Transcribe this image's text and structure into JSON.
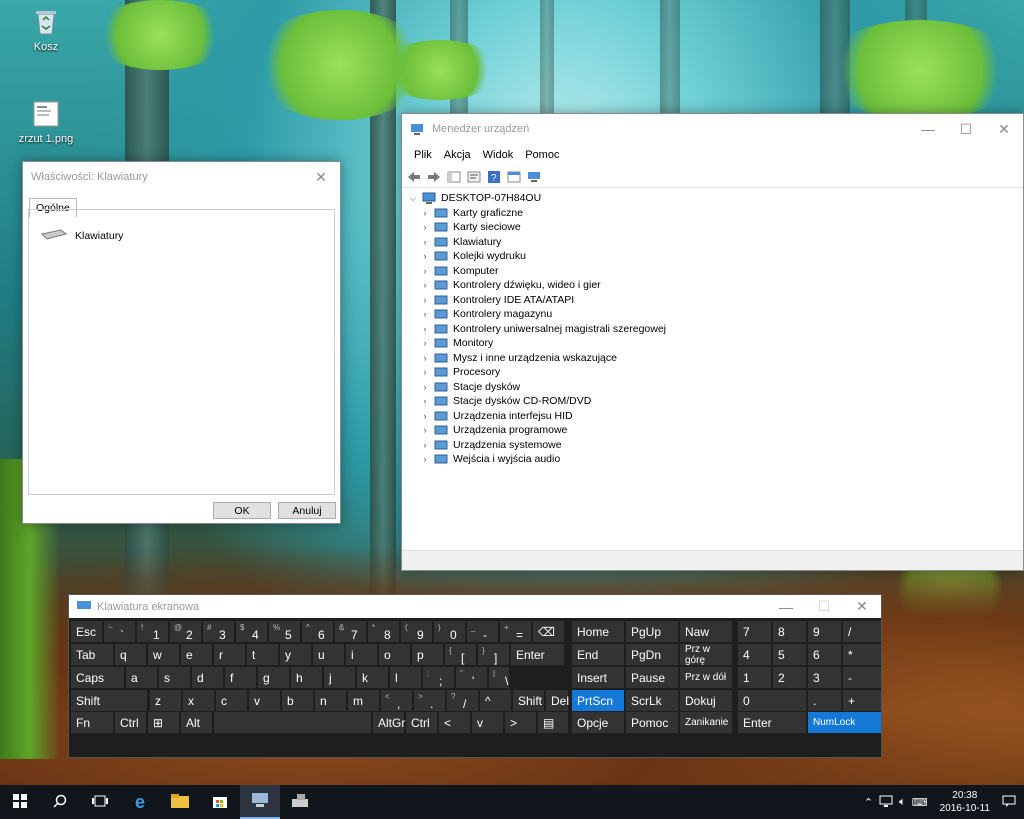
{
  "desktop": {
    "icons": [
      {
        "label": "Kosz",
        "icon": "recycle-bin-icon"
      },
      {
        "label": "zrzut 1.png",
        "icon": "image-file-icon"
      }
    ]
  },
  "device_manager": {
    "title": "Menedżer urządzeń",
    "menu": [
      "Plik",
      "Akcja",
      "Widok",
      "Pomoc"
    ],
    "root": "DESKTOP-07H84OU",
    "categories": [
      {
        "label": "Karty graficzne",
        "icon": "display-adapter-icon"
      },
      {
        "label": "Karty sieciowe",
        "icon": "network-adapter-icon"
      },
      {
        "label": "Klawiatury",
        "icon": "keyboard-icon"
      },
      {
        "label": "Kolejki wydruku",
        "icon": "printer-icon"
      },
      {
        "label": "Komputer",
        "icon": "computer-icon"
      },
      {
        "label": "Kontrolery dźwięku, wideo i gier",
        "icon": "speaker-icon"
      },
      {
        "label": "Kontrolery IDE ATA/ATAPI",
        "icon": "ide-controller-icon"
      },
      {
        "label": "Kontrolery magazynu",
        "icon": "storage-controller-icon"
      },
      {
        "label": "Kontrolery uniwersalnej magistrali szeregowej",
        "icon": "usb-icon"
      },
      {
        "label": "Monitory",
        "icon": "monitor-icon"
      },
      {
        "label": "Mysz i inne urządzenia wskazujące",
        "icon": "mouse-icon"
      },
      {
        "label": "Procesory",
        "icon": "processor-icon"
      },
      {
        "label": "Stacje dysków",
        "icon": "disk-drive-icon"
      },
      {
        "label": "Stacje dysków CD-ROM/DVD",
        "icon": "cdrom-icon"
      },
      {
        "label": "Urządzenia interfejsu HID",
        "icon": "hid-icon"
      },
      {
        "label": "Urządzenia programowe",
        "icon": "software-device-icon"
      },
      {
        "label": "Urządzenia systemowe",
        "icon": "system-device-icon"
      },
      {
        "label": "Wejścia i wyjścia audio",
        "icon": "audio-io-icon"
      }
    ]
  },
  "properties": {
    "title": "Właściwości: Klawiatury",
    "tab": "Ogólne",
    "device": "Klawiatury",
    "ok": "OK",
    "cancel": "Anuluj"
  },
  "osk": {
    "title": "Klawiatura ekranowa",
    "keys": [
      {
        "t": "Esc"
      },
      {
        "s": "~",
        "t": "`"
      },
      {
        "s": "!",
        "t": "1"
      },
      {
        "s": "@",
        "t": "2"
      },
      {
        "s": "#",
        "t": "3"
      },
      {
        "s": "$",
        "t": "4"
      },
      {
        "s": "%",
        "t": "5"
      },
      {
        "s": "^",
        "t": "6"
      },
      {
        "s": "&",
        "t": "7"
      },
      {
        "s": "*",
        "t": "8"
      },
      {
        "s": "(",
        "t": "9"
      },
      {
        "s": ")",
        "t": "0"
      },
      {
        "s": "_",
        "t": "-"
      },
      {
        "s": "+",
        "t": "="
      },
      {
        "t": "⌫"
      },
      {
        "t": "Home"
      },
      {
        "t": "PgUp"
      },
      {
        "t": "Naw"
      },
      {
        "t": "7"
      },
      {
        "t": "8"
      },
      {
        "t": "9"
      },
      {
        "t": "/"
      },
      {
        "t": "Tab"
      },
      {
        "t": "q"
      },
      {
        "t": "w"
      },
      {
        "t": "e"
      },
      {
        "t": "r"
      },
      {
        "t": "t"
      },
      {
        "t": "y"
      },
      {
        "t": "u"
      },
      {
        "t": "i"
      },
      {
        "t": "o"
      },
      {
        "t": "p"
      },
      {
        "s": "{",
        "t": "["
      },
      {
        "s": "}",
        "t": "]"
      },
      {
        "t": "Enter"
      },
      {
        "t": "End"
      },
      {
        "t": "PgDn"
      },
      {
        "t": "Prz w górę"
      },
      {
        "t": "4"
      },
      {
        "t": "5"
      },
      {
        "t": "6"
      },
      {
        "t": "*"
      },
      {
        "t": "Caps"
      },
      {
        "t": "a"
      },
      {
        "t": "s"
      },
      {
        "t": "d"
      },
      {
        "t": "f"
      },
      {
        "t": "g"
      },
      {
        "t": "h"
      },
      {
        "t": "j"
      },
      {
        "t": "k"
      },
      {
        "t": "l"
      },
      {
        "s": ":",
        "t": ";"
      },
      {
        "s": "\"",
        "t": "'"
      },
      {
        "s": "|",
        "t": "\\"
      },
      {
        "t": "Insert"
      },
      {
        "t": "Pause"
      },
      {
        "t": "Prz w dół"
      },
      {
        "t": "1"
      },
      {
        "t": "2"
      },
      {
        "t": "3"
      },
      {
        "t": "-"
      },
      {
        "t": "Shift"
      },
      {
        "t": "z"
      },
      {
        "t": "x"
      },
      {
        "t": "c"
      },
      {
        "t": "v"
      },
      {
        "t": "b"
      },
      {
        "t": "n"
      },
      {
        "t": "m"
      },
      {
        "s": "<",
        "t": ","
      },
      {
        "s": ">",
        "t": "."
      },
      {
        "s": "?",
        "t": "/"
      },
      {
        "t": "^"
      },
      {
        "t": "Shift"
      },
      {
        "t": "Del"
      },
      {
        "t": "PrtScn"
      },
      {
        "t": "ScrLk"
      },
      {
        "t": "Dokuj"
      },
      {
        "t": "0"
      },
      {
        "t": "."
      },
      {
        "t": "+"
      },
      {
        "t": "Fn"
      },
      {
        "t": "Ctrl"
      },
      {
        "t": "⊞"
      },
      {
        "t": "Alt"
      },
      {
        "t": ""
      },
      {
        "t": "AltGr"
      },
      {
        "t": "Ctrl"
      },
      {
        "t": "<"
      },
      {
        "t": "v"
      },
      {
        "t": ">"
      },
      {
        "t": "▤"
      },
      {
        "t": "Opcje"
      },
      {
        "t": "Pomoc"
      },
      {
        "t": "Zanikanie"
      },
      {
        "t": "Enter"
      },
      {
        "t": "NumLock"
      }
    ],
    "active_keys": [
      "PrtScn",
      "NumLock"
    ]
  },
  "taskbar": {
    "time": "20:38",
    "date": "2016-10-11"
  },
  "colors": {
    "accent": "#1478d6",
    "taskbar": "#10161c",
    "key_bg": "#333333"
  }
}
